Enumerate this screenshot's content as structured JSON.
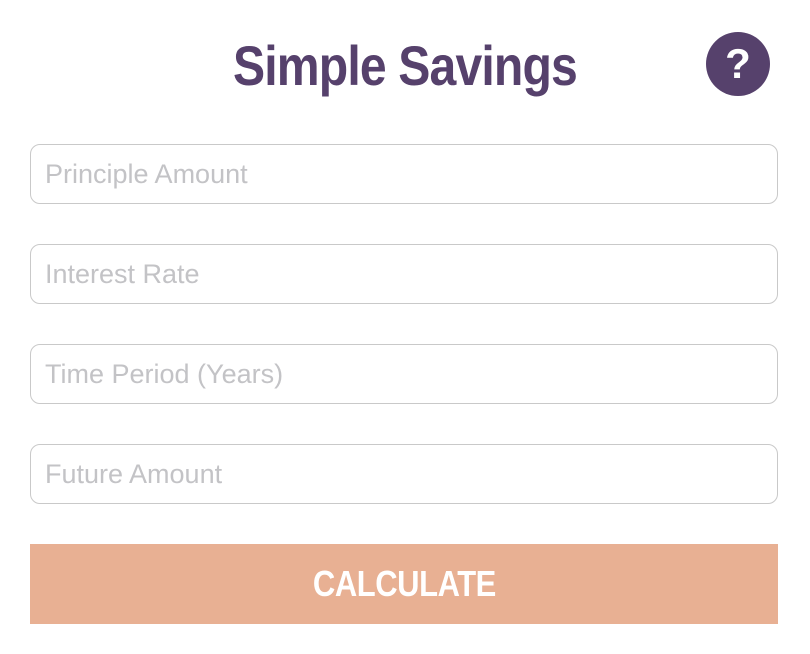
{
  "app": {
    "title": "Simple Savings",
    "help_label": "?"
  },
  "form": {
    "principal": {
      "placeholder": "Principle Amount",
      "value": ""
    },
    "interest_rate": {
      "placeholder": "Interest Rate",
      "value": ""
    },
    "time_period": {
      "placeholder": "Time Period (Years)",
      "value": ""
    },
    "future_amount": {
      "placeholder": "Future Amount",
      "value": ""
    },
    "calculate_label": "CALCULATE"
  },
  "colors": {
    "brand_purple": "#56416c",
    "accent_peach": "#e8b093",
    "field_border": "#c9c9c9",
    "placeholder": "#c3c3c6"
  },
  "icons": {
    "help": "question-mark-icon"
  }
}
